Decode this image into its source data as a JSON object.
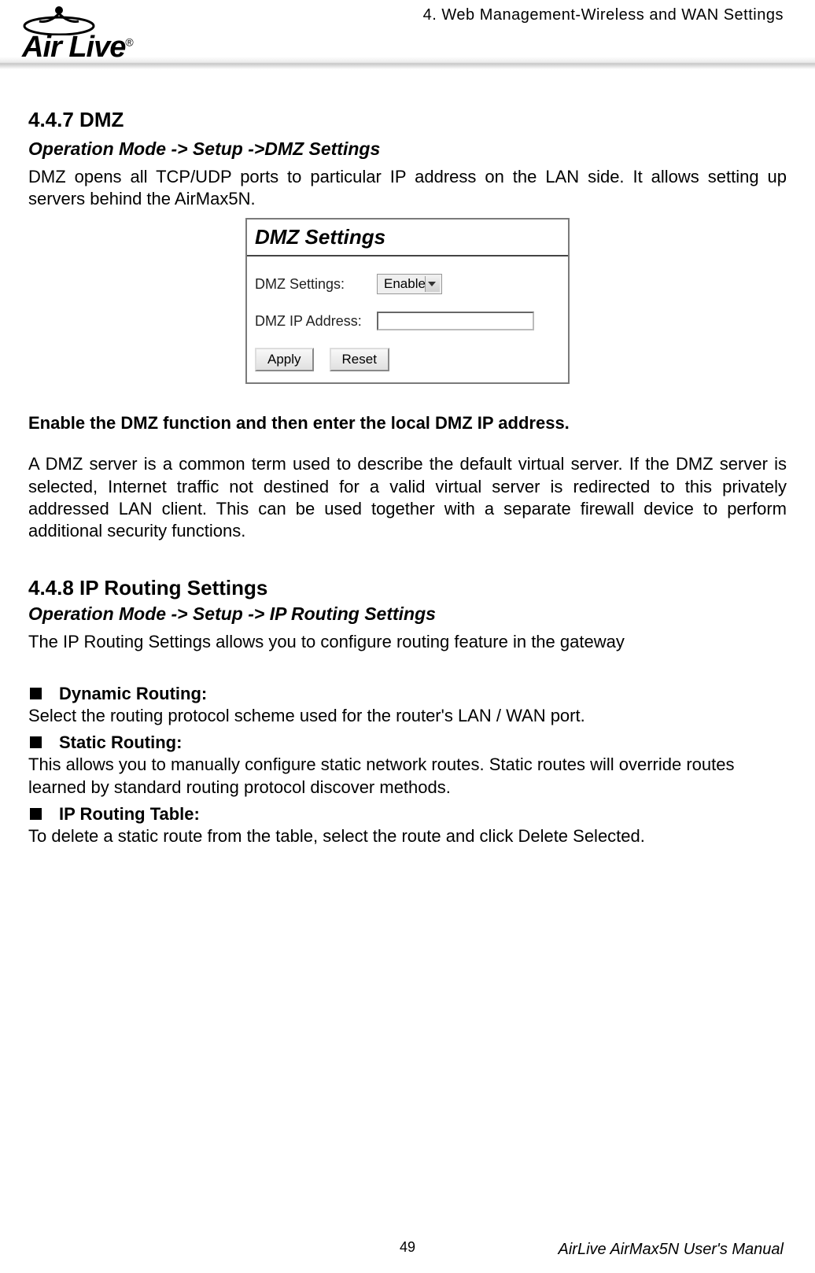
{
  "header": {
    "logo_brand": "Air Live",
    "chapter_title": "4. Web Management-Wireless and WAN Settings"
  },
  "section_dmz": {
    "heading": "4.4.7 DMZ",
    "op_mode": "Operation Mode -> Setup ->DMZ Settings",
    "intro": "DMZ opens all TCP/UDP ports to particular IP address on the LAN side. It allows setting up servers behind the AirMax5N.",
    "screenshot": {
      "title": "DMZ Settings",
      "row1_label": "DMZ Settings:",
      "row1_value": "Enable",
      "row2_label": "DMZ IP Address:",
      "row2_value": "",
      "btn_apply": "Apply",
      "btn_reset": "Reset"
    },
    "instruction_bold": "Enable the DMZ function and then enter the local DMZ IP address.",
    "desc": "A DMZ server is a common term used to describe the default virtual server. If the DMZ server is selected, Internet traffic not destined for a valid virtual server is redirected to this privately addressed LAN client. This can be used together with a separate firewall device to perform additional security functions."
  },
  "section_routing": {
    "heading": "4.4.8 IP Routing Settings",
    "op_mode": "Operation Mode -> Setup -> IP Routing Settings",
    "intro": "The IP Routing Settings allows you to configure routing feature in the gateway",
    "bullets": [
      {
        "head": "Dynamic Routing:",
        "body": "Select the routing protocol scheme used for the router's LAN / WAN port."
      },
      {
        "head": "Static Routing:",
        "body": "This allows you to manually configure static network routes. Static routes will override routes learned by standard routing protocol discover methods."
      },
      {
        "head": "IP Routing Table:",
        "body": "To delete a static route from the table, select the route and click Delete Selected."
      }
    ]
  },
  "footer": {
    "page_number": "49",
    "manual_title": "AirLive AirMax5N User's Manual"
  }
}
